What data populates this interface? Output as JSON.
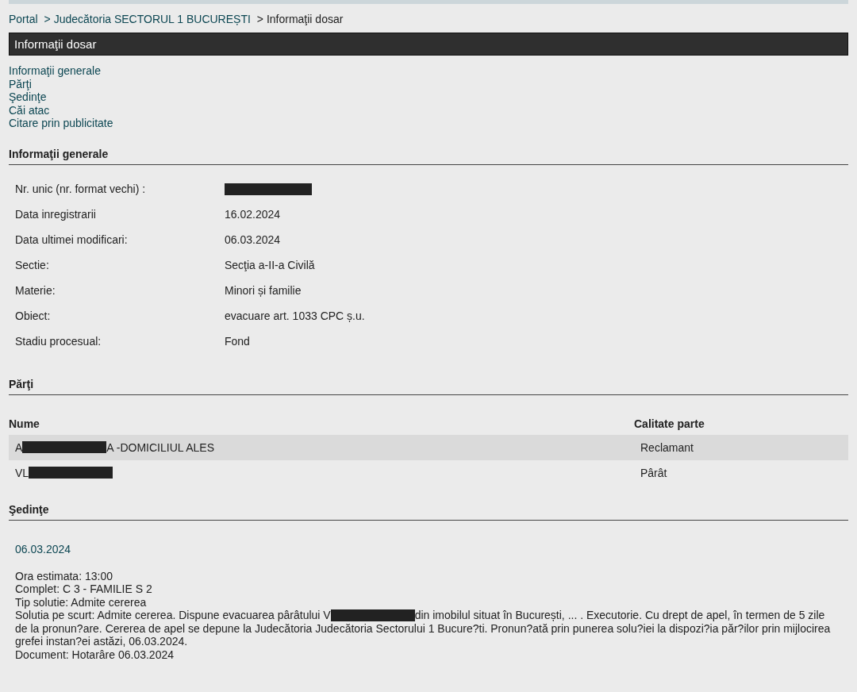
{
  "breadcrumb": [
    {
      "text": "Portal",
      "kind": "link"
    },
    {
      "text": "> Judecătoria SECTORUL 1 BUCUREȘTI",
      "kind": "link"
    },
    {
      "text": "> Informaţii dosar",
      "kind": "current"
    }
  ],
  "header": {
    "title": "Informaţii dosar"
  },
  "nav_links": [
    "Informaţii generale",
    "Părţi",
    "Şedinţe",
    "Căi atac",
    "Citare prin publicitate"
  ],
  "general": {
    "title": "Informaţii generale",
    "rows": [
      {
        "label": "Nr. unic (nr. format vechi) :",
        "parts": [
          {
            "kind": "redaction"
          }
        ]
      },
      {
        "label": "Data inregistrarii",
        "parts": [
          {
            "kind": "text",
            "text": "16.02.2024"
          }
        ]
      },
      {
        "label": "Data ultimei modificari:",
        "parts": [
          {
            "kind": "text",
            "text": "06.03.2024"
          }
        ]
      },
      {
        "label": "Sectie:",
        "parts": [
          {
            "kind": "text",
            "text": "Secţia a-II-a Civilă"
          }
        ]
      },
      {
        "label": "Materie:",
        "parts": [
          {
            "kind": "text",
            "text": "Minori și familie"
          }
        ]
      },
      {
        "label": "Obiect:",
        "parts": [
          {
            "kind": "text",
            "text": "evacuare art. 1033 CPC ș.u."
          }
        ]
      },
      {
        "label": "Stadiu procesual:",
        "parts": [
          {
            "kind": "text",
            "text": "Fond"
          }
        ]
      }
    ]
  },
  "parties": {
    "title": "Părţi",
    "columns": [
      "Nume",
      "Calitate parte"
    ],
    "rows": [
      {
        "name_parts": [
          {
            "kind": "text",
            "text": "A"
          },
          {
            "kind": "redaction"
          },
          {
            "kind": "text",
            "text": "A -DOMICILIUL ALES"
          }
        ],
        "role": "Reclamant"
      },
      {
        "name_parts": [
          {
            "kind": "text",
            "text": "VL"
          },
          {
            "kind": "redaction"
          }
        ],
        "role": "Pârât"
      }
    ]
  },
  "hearings": {
    "title": "Şedinţe",
    "items": [
      {
        "date": "06.03.2024",
        "lines": [
          [
            {
              "kind": "text",
              "text": "Ora estimata: 13:00"
            }
          ],
          [
            {
              "kind": "text",
              "text": "Complet: C 3 - FAMILIE S 2"
            }
          ],
          [
            {
              "kind": "text",
              "text": "Tip solutie: Admite cererea"
            }
          ],
          [
            {
              "kind": "text",
              "text": "Solutia pe scurt: Admite cererea. Dispune evacuarea pârâtului V"
            },
            {
              "kind": "redaction"
            },
            {
              "kind": "text",
              "text": "din imobilul situat în București, ... . Executorie. Cu drept de apel, în termen de 5 zile"
            }
          ],
          [
            {
              "kind": "text",
              "text": "de la pronun?are. Cererea de apel se depune la Judecătoria Judecătoria Sectorului 1 Bucure?ti. Pronun?ată prin punerea solu?iei la dispozi?ia păr?ilor prin mijlocirea grefei instan?ei astăzi, 06.03.2024."
            }
          ],
          [
            {
              "kind": "text",
              "text": "Document: Hotarâre    06.03.2024"
            }
          ]
        ]
      }
    ]
  }
}
